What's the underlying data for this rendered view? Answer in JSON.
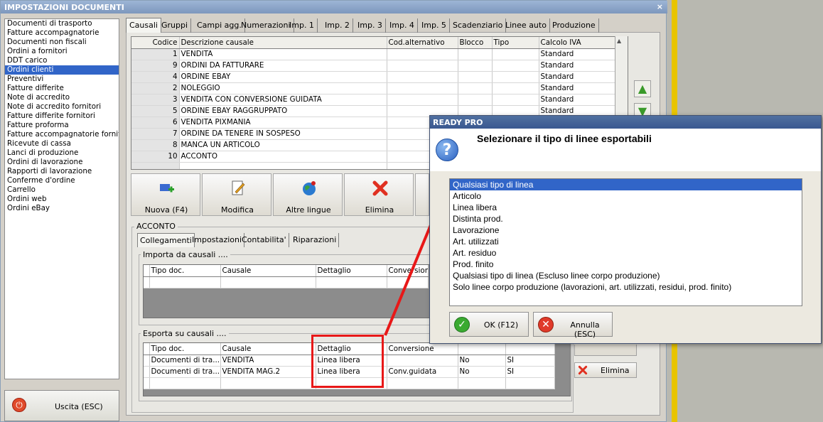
{
  "window": {
    "title": "IMPOSTAZIONI DOCUMENTI",
    "close": "×"
  },
  "left_list": {
    "items": [
      "Documenti di trasporto",
      "Fatture accompagnatorie",
      "Documenti non fiscali",
      "Ordini a fornitori",
      "DDT carico",
      "Ordini clienti",
      "Preventivi",
      "Fatture differite",
      "Note di accredito",
      "Note di accredito fornitori",
      "Fatture differite fornitori",
      "Fatture proforma",
      "Fatture accompagnatorie fornito",
      "Ricevute di cassa",
      "Lanci di produzione",
      "Ordini di lavorazione",
      "Rapporti di lavorazione",
      "Conferme d'ordine",
      "Carrello",
      "Ordini web",
      "Ordini eBay"
    ],
    "selected_index": 5
  },
  "exit_button": {
    "label": "Uscita (ESC)"
  },
  "tabs": [
    "Causali",
    "Gruppi",
    "Campi agg.",
    "Numerazioni",
    "Imp. 1",
    "Imp. 2",
    "Imp. 3",
    "Imp. 4",
    "Imp. 5",
    "Scadenziario",
    "Linee auto",
    "Produzione"
  ],
  "grid": {
    "headers": [
      "Codice",
      "Descrizione causale",
      "Cod.alternativo",
      "Blocco",
      "Tipo",
      "Calcolo IVA"
    ],
    "rows": [
      [
        "1",
        "VENDITA",
        "",
        "",
        "",
        "Standard"
      ],
      [
        "9",
        "ORDINI DA FATTURARE",
        "",
        "",
        "",
        "Standard"
      ],
      [
        "4",
        "ORDINE EBAY",
        "",
        "",
        "",
        "Standard"
      ],
      [
        "2",
        "NOLEGGIO",
        "",
        "",
        "",
        "Standard"
      ],
      [
        "3",
        "VENDITA CON CONVERSIONE GUIDATA",
        "",
        "",
        "",
        "Standard"
      ],
      [
        "5",
        "ORDINE EBAY RAGGRUPPATO",
        "",
        "",
        "",
        "Standard"
      ],
      [
        "6",
        "VENDITA PIXMANIA",
        "",
        "",
        "",
        ""
      ],
      [
        "7",
        "ORDINE DA TENERE IN SOSPESO",
        "",
        "",
        "",
        ""
      ],
      [
        "8",
        "MANCA UN ARTICOLO",
        "",
        "",
        "",
        ""
      ],
      [
        "10",
        "ACCONTO",
        "",
        "",
        "",
        ""
      ]
    ]
  },
  "toolbar": {
    "new": "Nuova (F4)",
    "edit": "Modifica",
    "languages": "Altre lingue",
    "delete": "Elimina"
  },
  "acconto": {
    "title": "ACCONTO",
    "subtabs": [
      "Collegamenti",
      "Impostazioni",
      "Contabilita'",
      "Riparazioni"
    ],
    "import_label": "Importa da causali ....",
    "import_headers": [
      "Tipo doc.",
      "Causale",
      "Dettaglio",
      "Conversione"
    ],
    "export_label": "Esporta su causali ....",
    "export_headers": [
      "Tipo doc.",
      "Causale",
      "Dettaglio",
      "Conversione",
      "",
      ""
    ],
    "export_rows": [
      [
        "Documenti di tra...",
        "VENDITA",
        "Linea libera",
        "",
        "No",
        "SI"
      ],
      [
        "Documenti di tra...",
        "VENDITA MAG.2",
        "Linea libera",
        "Conv.guidata",
        "No",
        "SI"
      ]
    ],
    "delete_label": "Elimina"
  },
  "dialog": {
    "title": "READY PRO",
    "message": "Selezionare il tipo di linee esportabili",
    "options": [
      "Qualsiasi tipo di linea",
      "Articolo",
      "Linea libera",
      "Distinta prod.",
      "Lavorazione",
      "Art. utilizzati",
      "Art. residuo",
      "Prod. finito",
      "Qualsiasi tipo di linea (Escluso linee corpo produzione)",
      "Solo linee corpo produzione (lavorazioni, art. utilizzati, residui, prod. finito)"
    ],
    "selected_index": 0,
    "ok_label": "OK (F12)",
    "cancel_label": "Annulla (ESC)"
  },
  "colors": {
    "selection": "#3165c8",
    "annotation": "#e81818",
    "title_bar": "#7d97bd"
  }
}
